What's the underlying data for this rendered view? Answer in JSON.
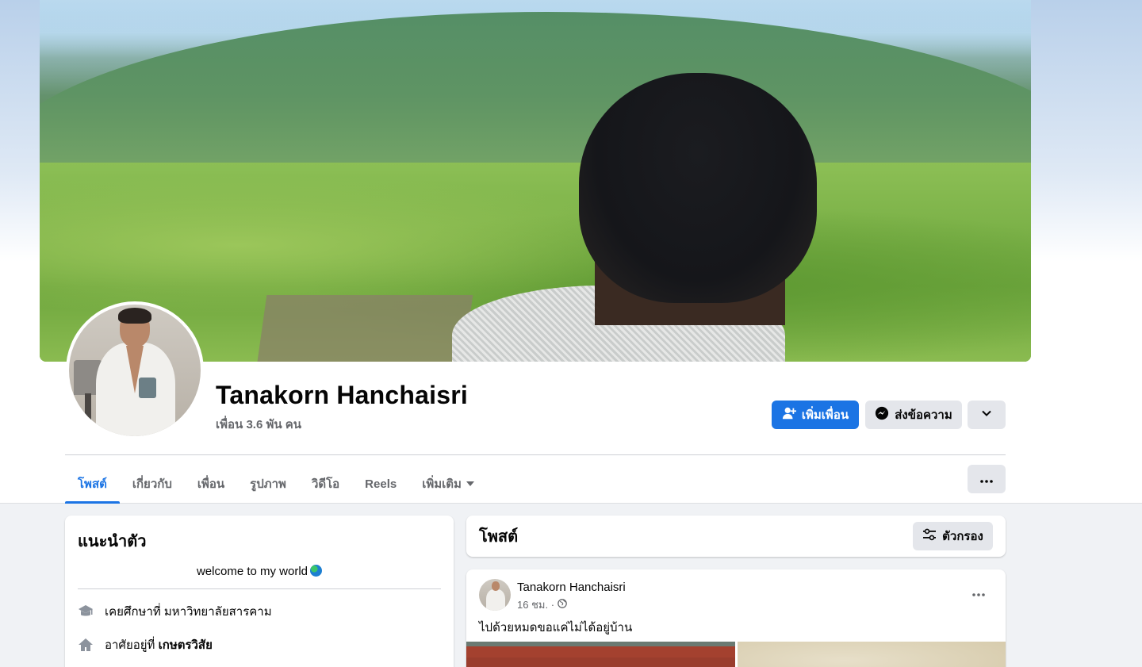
{
  "profile": {
    "name": "Tanakorn Hanchaisri",
    "friends_count": "เพื่อน 3.6 พัน คน"
  },
  "actions": {
    "add_friend_label": "เพิ่มเพื่อน",
    "message_label": "ส่งข้อความ"
  },
  "tabs": [
    {
      "label": "โพสต์",
      "active": true
    },
    {
      "label": "เกี่ยวกับ",
      "active": false
    },
    {
      "label": "เพื่อน",
      "active": false
    },
    {
      "label": "รูปภาพ",
      "active": false
    },
    {
      "label": "วิดีโอ",
      "active": false
    },
    {
      "label": "Reels",
      "active": false
    },
    {
      "label": "เพิ่มเติม",
      "active": false
    }
  ],
  "intro": {
    "title": "แนะนำตัว",
    "bio": "welcome to my world",
    "education_prefix": "เคยศึกษาที่ ",
    "education_value": "มหาวิทยาลัยสารคาม",
    "lives_prefix": "อาศัยอยู่ที่ ",
    "lives_value": "เกษตรวิสัย"
  },
  "posts_section": {
    "title": "โพสต์",
    "filter_label": "ตัวกรอง"
  },
  "post": {
    "author": "Tanakorn Hanchaisri",
    "time": "16 ชม. ·",
    "text": "ไปด้วยหมดขอแค่ไม่ได้อยู่บ้าน"
  },
  "colors": {
    "primary": "#1b74e4",
    "secondary_button": "#e4e6eb",
    "muted_text": "#65676b",
    "page_background": "#f0f2f5"
  }
}
